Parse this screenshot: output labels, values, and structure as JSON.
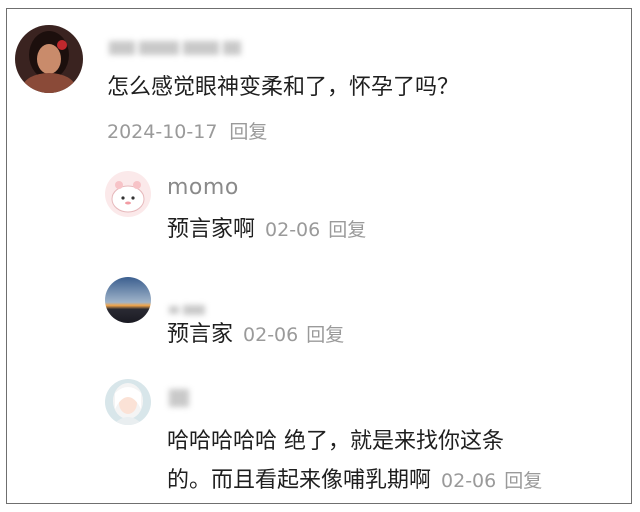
{
  "comment": {
    "text": "怎么感觉眼神变柔和了，怀孕了吗？",
    "date": "2024-10-17",
    "reply_label": "回复"
  },
  "replies": [
    {
      "username": "momo",
      "text": "预言家啊",
      "date": "02-06",
      "reply_label": "回复"
    },
    {
      "username": "",
      "text": "预言家",
      "date": "02-06",
      "reply_label": "回复"
    },
    {
      "username": "",
      "text_line1": "哈哈哈哈哈 绝了，就是来找你这条",
      "text_line2": "的。而且看起来像哺乳期啊",
      "date": "02-06",
      "reply_label": "回复"
    }
  ]
}
